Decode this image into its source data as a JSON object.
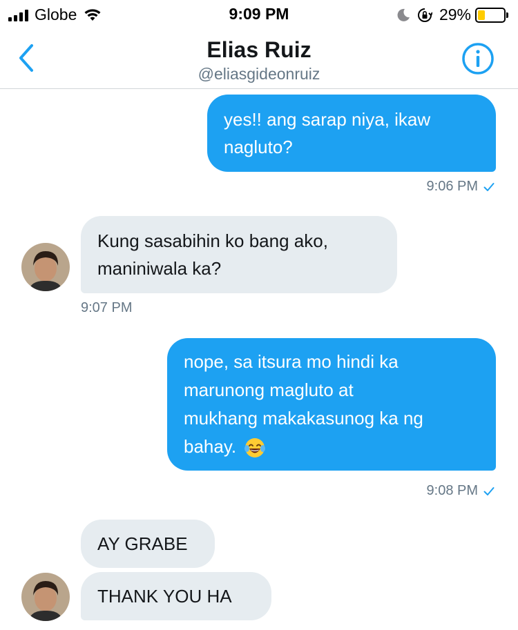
{
  "status_bar": {
    "carrier": "Globe",
    "time": "9:09 PM",
    "battery_percent": "29%",
    "battery_level": 0.29,
    "battery_color": "#ffcc00"
  },
  "header": {
    "name": "Elias Ruiz",
    "handle": "@eliasgideonruiz",
    "back_icon": "chevron-left-icon",
    "info_icon": "info-circle-icon"
  },
  "colors": {
    "accent": "#1da1f2",
    "incoming_bubble": "#e6ecf0",
    "secondary_text": "#657786"
  },
  "messages": [
    {
      "direction": "out",
      "lines": [
        "yes!! ang sarap niya, ikaw",
        "nagluto?"
      ],
      "time": "9:06 PM"
    },
    {
      "direction": "in",
      "lines": [
        "Kung sasabihin ko bang ako,",
        "maniniwala ka?"
      ],
      "time": "9:07 PM"
    },
    {
      "direction": "out",
      "lines": [
        "nope, sa itsura mo hindi ka",
        "marunong magluto at",
        "mukhang makakasunog ka ng",
        "bahay."
      ],
      "emoji": "face-with-tears-of-joy",
      "time": "9:08 PM"
    },
    {
      "direction": "in",
      "lines": [
        "AY GRABE"
      ]
    },
    {
      "direction": "in",
      "lines": [
        "THANK YOU HA"
      ]
    }
  ]
}
